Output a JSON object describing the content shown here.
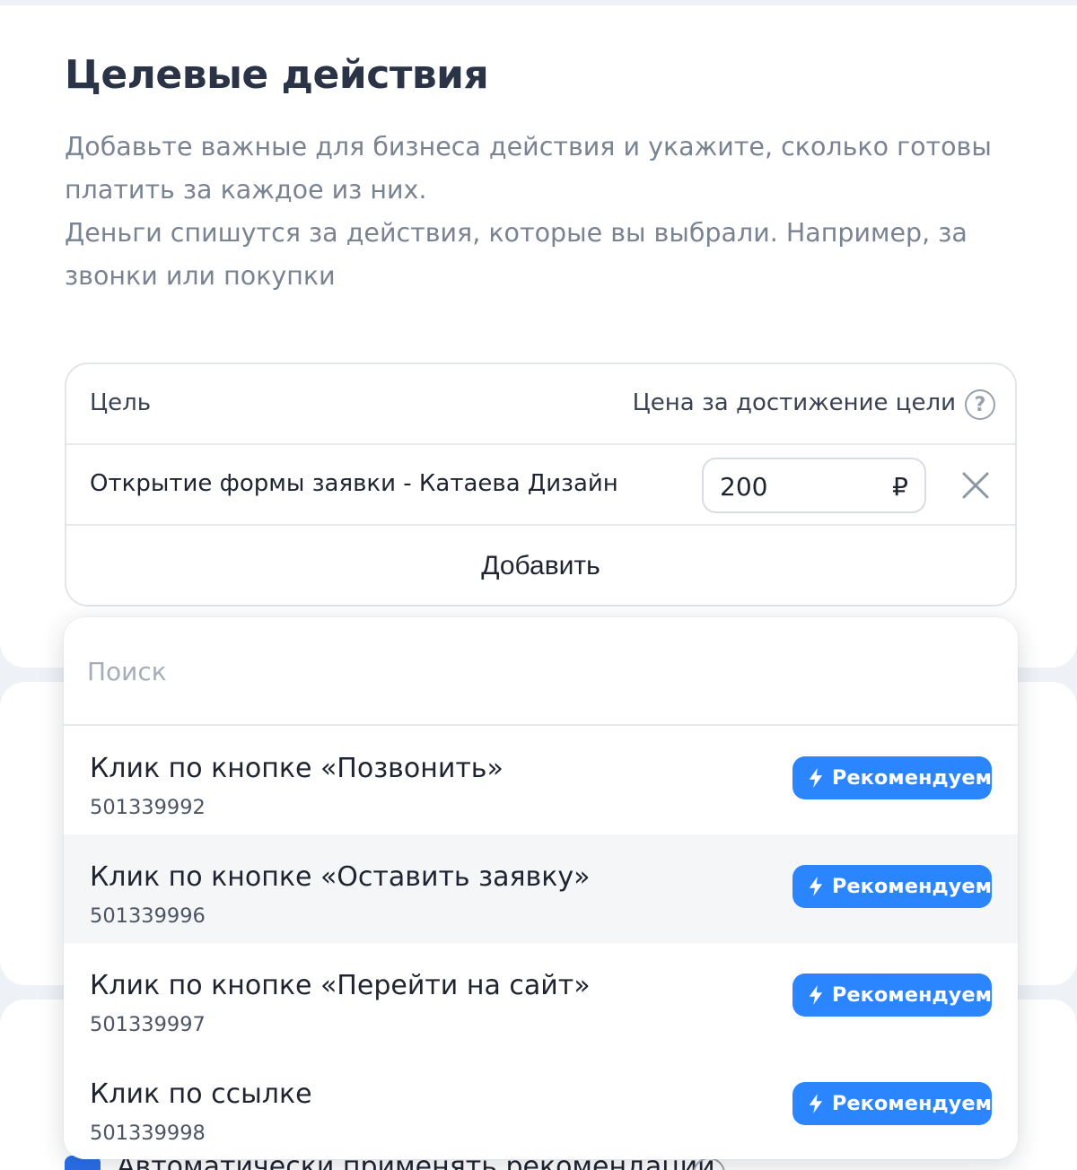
{
  "section": {
    "title": "Целевые действия",
    "description_line1": "Добавьте важные для бизнеса действия и укажите, сколько готовы платить за каждое из них.",
    "description_line2": "Деньги спишутся за действия, которые вы выбрали. Например, за звонки или покупки"
  },
  "goals_table": {
    "header_goal": "Цель",
    "header_price": "Цена за достижение цели",
    "rows": [
      {
        "name": "Открытие формы заявки - Катаева Дизайн",
        "price": "200",
        "currency": "₽"
      }
    ],
    "add_label": "Добавить"
  },
  "dropdown": {
    "search_placeholder": "Поиск",
    "badge_label": "Рекомендуем",
    "options": [
      {
        "title": "Клик по кнопке «Позвонить»",
        "id": "501339992"
      },
      {
        "title": "Клик по кнопке «Оставить заявку»",
        "id": "501339996"
      },
      {
        "title": "Клик по кнопке «Перейти на сайт»",
        "id": "501339997"
      },
      {
        "title": "Клик по ссылке",
        "id": "501339998"
      }
    ]
  },
  "auto_apply": {
    "label": "Автоматически применять рекомендации"
  },
  "colors": {
    "accent": "#2a85ff",
    "title": "#2b3446",
    "muted": "#7a8392"
  }
}
